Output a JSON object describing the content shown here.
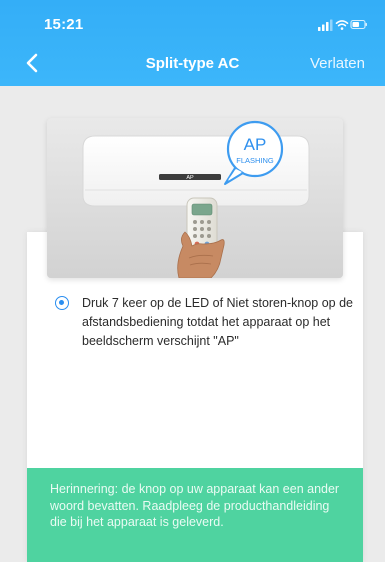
{
  "status_bar": {
    "time": "15:21"
  },
  "header": {
    "title": "Split-type AC",
    "leave_label": "Verlaten"
  },
  "illustration": {
    "bubble_big": "AP",
    "bubble_small": "FLASHING",
    "display_text": "AP"
  },
  "instruction": {
    "text": "Druk 7 keer op de LED of Niet storen-knop op de afstandsbediening totdat het apparaat op het beeldscherm verschijnt \"AP\""
  },
  "reminder": {
    "text": "Herinnering: de knop op uw apparaat kan een ander woord bevatten. Raadpleeg de producthandleiding die bij het apparaat is geleverd."
  },
  "colors": {
    "header": "#36b0f8",
    "accent": "#2a8ef0",
    "reminder_bg": "#4fd3a0"
  }
}
